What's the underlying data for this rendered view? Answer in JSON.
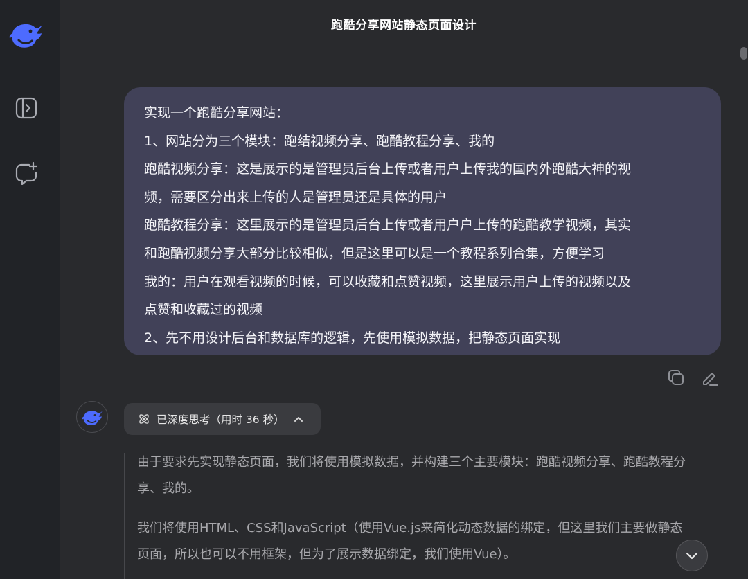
{
  "app": {
    "title": "跑酷分享网站静态页面设计"
  },
  "sidebar": {
    "logo_icon": "deepseek-whale-logo",
    "items": [
      {
        "icon": "open-sidebar-icon"
      },
      {
        "icon": "new-chat-icon"
      }
    ]
  },
  "colors": {
    "accent": "#4d6bfe",
    "user_bubble": "#414158",
    "sidebar_bg": "#212327",
    "main_bg": "#292a2d"
  },
  "user_message": {
    "lines": [
      "实现一个跑酷分享网站：",
      "1、网站分为三个模块：跑结视频分享、跑酷教程分享、我的",
      "跑酷视频分享：这是展示的是管理员后台上传或者用户上传我的国内外跑酷大神的视",
      "频，需要区分出来上传的人是管理员还是具体的用户",
      "跑酷教程分享：这里展示的是管理员后台上传或者用户户上传的跑酷教学视频，其实",
      "和跑酷视频分享大部分比较相似，但是这里可以是一个教程系列合集，方便学习",
      "我的：用户在观看视频的时候，可以收藏和点赞视频，这里展示用户上传的视频以及",
      "点赞和收藏过的视频",
      "2、先不用设计后台和数据库的逻辑，先使用模拟数据，把静态页面实现"
    ],
    "actions": [
      {
        "icon": "copy-icon"
      },
      {
        "icon": "edit-icon"
      }
    ]
  },
  "assistant": {
    "avatar_icon": "deepseek-whale-logo",
    "thinking": {
      "label": "已深度思考（用时 36 秒）",
      "icon": "atom-icon",
      "toggle_icon": "chevron-up-icon"
    },
    "paragraphs": [
      {
        "lines": [
          "由于要求先实现静态页面，我们将使用模拟数据，并构建三个主要模块：跑酷视频分享、跑酷教程分",
          "享、我的。"
        ]
      },
      {
        "lines": [
          "我们将使用HTML、CSS和JavaScript（使用Vue.js来简化动态数据的绑定，但这里我们主要做静态",
          "页面，所以也可以不用框架，但为了展示数据绑定，我们使用Vue）。"
        ]
      }
    ]
  },
  "scroll_button": {
    "icon": "chevron-down-icon"
  }
}
